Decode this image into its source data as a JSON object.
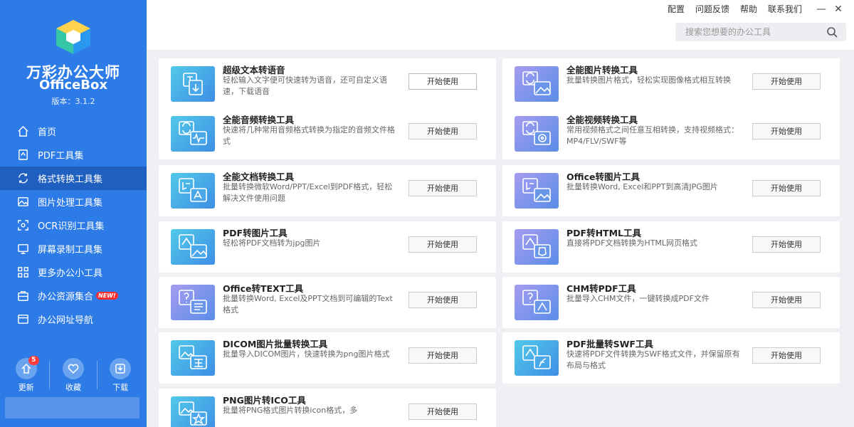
{
  "app": {
    "title": "万彩办公大师",
    "subtitle": "OfficeBox",
    "version": "版本：3.1.2"
  },
  "nav": [
    {
      "label": "首页",
      "icon": "home-icon"
    },
    {
      "label": "PDF工具集",
      "icon": "pdf-icon"
    },
    {
      "label": "格式转换工具集",
      "icon": "convert-icon",
      "active": true
    },
    {
      "label": "图片处理工具集",
      "icon": "image-icon"
    },
    {
      "label": "OCR识别工具集",
      "icon": "ocr-icon"
    },
    {
      "label": "屏幕录制工具集",
      "icon": "monitor-icon"
    },
    {
      "label": "更多办公小工具",
      "icon": "grid-icon"
    },
    {
      "label": "办公资源集合",
      "icon": "briefcase-icon",
      "badge": "NEW!"
    },
    {
      "label": "办公网址导航",
      "icon": "browser-icon"
    }
  ],
  "bottom": [
    {
      "label": "更新",
      "icon": "update-icon",
      "count": "5"
    },
    {
      "label": "收藏",
      "icon": "heart-icon"
    },
    {
      "label": "下载",
      "icon": "download-icon"
    }
  ],
  "top_links": [
    "配置",
    "问题反馈",
    "帮助",
    "联系我们"
  ],
  "search": {
    "placeholder": "搜索您想要的办公工具"
  },
  "button_label": "开始使用",
  "cards": [
    {
      "title": "超级文本转语音",
      "desc": "轻松输入文字便可快速转为语音，还可自定义语速，下载语音",
      "icon": "text-to-speech-icon"
    },
    {
      "title": "全能图片转换工具",
      "desc": "批量转换图片格式，轻松实现图像格式相互转换",
      "icon": "image-convert-icon"
    },
    {
      "title": "全能音频转换工具",
      "desc": "快速将几种常用音频格式转换为指定的音频文件格式",
      "icon": "audio-convert-icon"
    },
    {
      "title": "全能视频转换工具",
      "desc": "常用视频格式之间任意互相转换，支持视频格式：MP4/FLV/SWF等",
      "icon": "video-convert-icon"
    },
    {
      "title": "全能文档转换工具",
      "desc": "批量转换微软Word/PPT/Excel到PDF格式，轻松解决文件使用问题",
      "icon": "document-convert-icon"
    },
    {
      "title": "Office转图片工具",
      "desc": "批量转换Word, Excel和PPT到高清JPG图片",
      "icon": "office-to-image-icon"
    },
    {
      "title": "PDF转图片工具",
      "desc": "轻松将PDF文档转为jpg图片",
      "icon": "pdf-to-image-icon"
    },
    {
      "title": "PDF转HTML工具",
      "desc": "直接将PDF文档转换为HTML网页格式",
      "icon": "pdf-to-html-icon"
    },
    {
      "title": "Office转TEXT工具",
      "desc": "批量转换Word, Excel及PPT文档到可编辑的Text格式",
      "icon": "office-to-text-icon"
    },
    {
      "title": "CHM转PDF工具",
      "desc": "批量导入CHM文件，一键转换成PDF文件",
      "icon": "chm-to-pdf-icon"
    },
    {
      "title": "DICOM图片批量转换工具",
      "desc": "批量导入DICOM图片，快速转换为png图片格式",
      "icon": "dicom-convert-icon"
    },
    {
      "title": "PDF批量转SWF工具",
      "desc": "快速将PDF文件转换为SWF格式文件，并保留原有布局与格式",
      "icon": "pdf-to-swf-icon"
    },
    {
      "title": "PNG图片转ICO工具",
      "desc": "批量将PNG格式图片转换icon格式，多",
      "icon": "png-to-ico-icon"
    }
  ]
}
